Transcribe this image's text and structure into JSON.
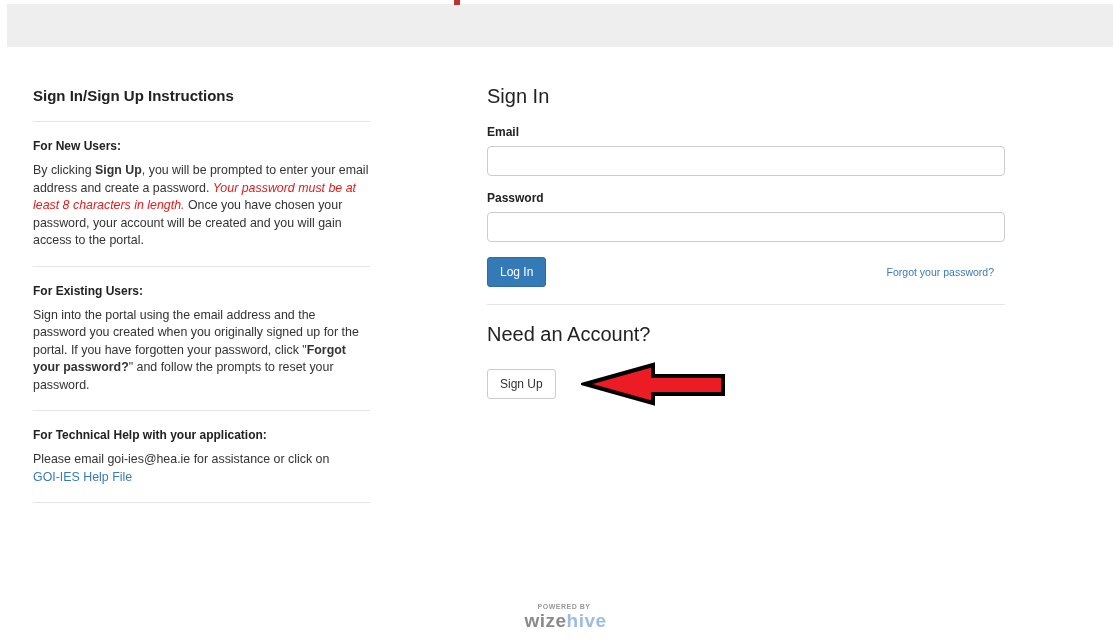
{
  "instructions": {
    "title": "Sign In/Sign Up Instructions",
    "sections": [
      {
        "heading": "For New Users:",
        "body": "By clicking **Sign Up**, you will be prompted to enter your email address and create a password. *Your password must be at least 8 characters in length.* Once you have chosen your password, your account will be created and you will gain access to the portal."
      },
      {
        "heading": "For Existing Users:",
        "body": "Sign into the portal using the email address and the password you created when you originally signed up for the portal. If you have forgotten your password, click \"**Forgot your password?**\" and follow the prompts to reset your password."
      },
      {
        "heading": "For Technical Help with your application:",
        "body": "Please email goi-ies@hea.ie for assistance  or click on",
        "link": "GOI-IES Help File"
      }
    ]
  },
  "sign_in": {
    "title": "Sign In",
    "fields": [
      {
        "label": "Email"
      },
      {
        "label": "Password"
      }
    ],
    "login_button": "Log In",
    "forgot_link": "Forgot your password?"
  },
  "sign_up": {
    "title": "Need an Account?",
    "button": "Sign Up"
  },
  "footer": {
    "powered_by": "POWERED BY",
    "logo_parts": [
      {
        "text": "wize",
        "color": "#8a8a8a"
      },
      {
        "text": "hive",
        "color": "#9dbde0"
      }
    ]
  }
}
